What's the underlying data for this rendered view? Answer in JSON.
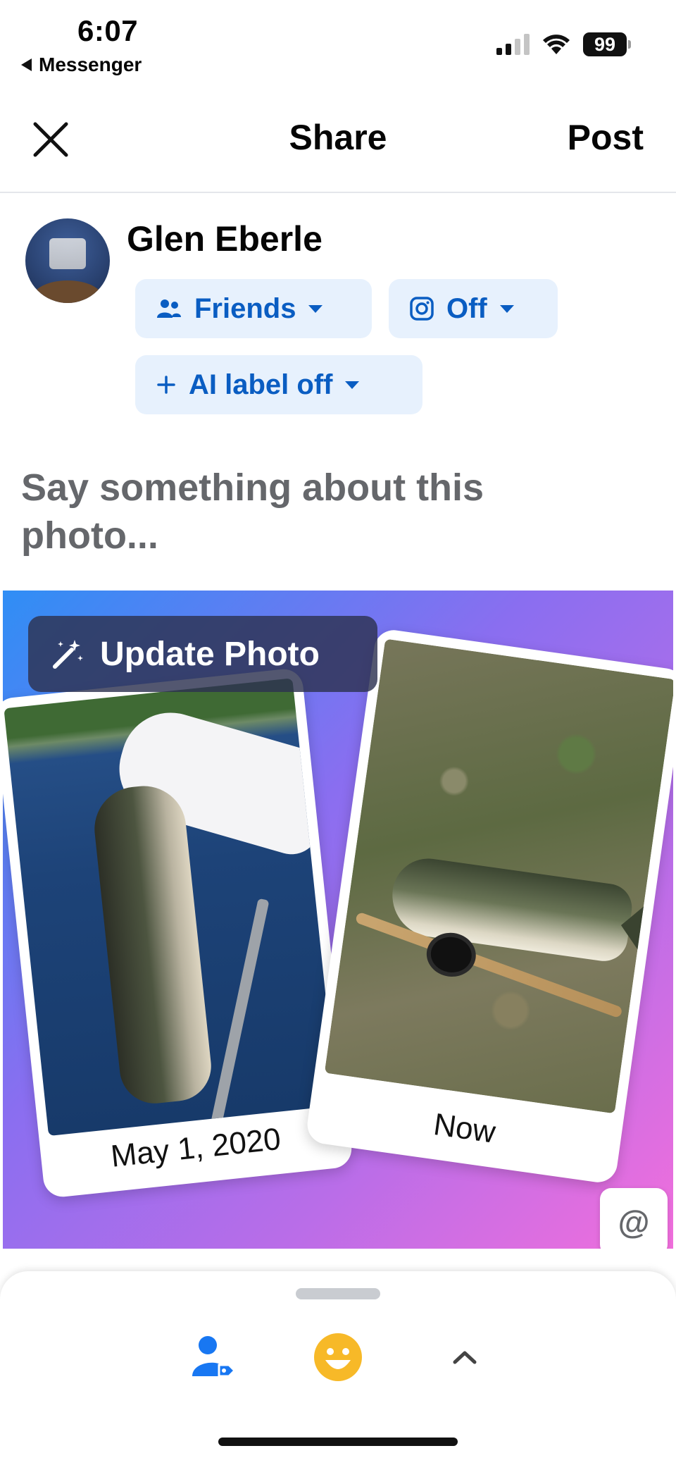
{
  "status_bar": {
    "time": "6:07",
    "back_app": "Messenger",
    "battery": "99"
  },
  "header": {
    "title": "Share",
    "post_label": "Post",
    "close_icon": "close-icon"
  },
  "composer": {
    "user_name": "Glen Eberle",
    "audience_label": "Friends",
    "instagram_label": "Off",
    "ai_label": "AI label off",
    "placeholder": "Say something about this photo..."
  },
  "photo": {
    "update_label": "Update Photo",
    "then_caption": "May 1, 2020",
    "now_caption": "Now",
    "mention_icon": "@",
    "gradient_colors": [
      "#2f8ef5",
      "#8a6ef0",
      "#f16fdc"
    ]
  },
  "bottom_sheet": {
    "icons": [
      "tag-people-icon",
      "emoji-icon",
      "chevron-up-icon"
    ]
  },
  "colors": {
    "accent_blue": "#0a5dc2",
    "pill_bg": "#e7f1fd",
    "emoji_yellow": "#f7b928"
  }
}
